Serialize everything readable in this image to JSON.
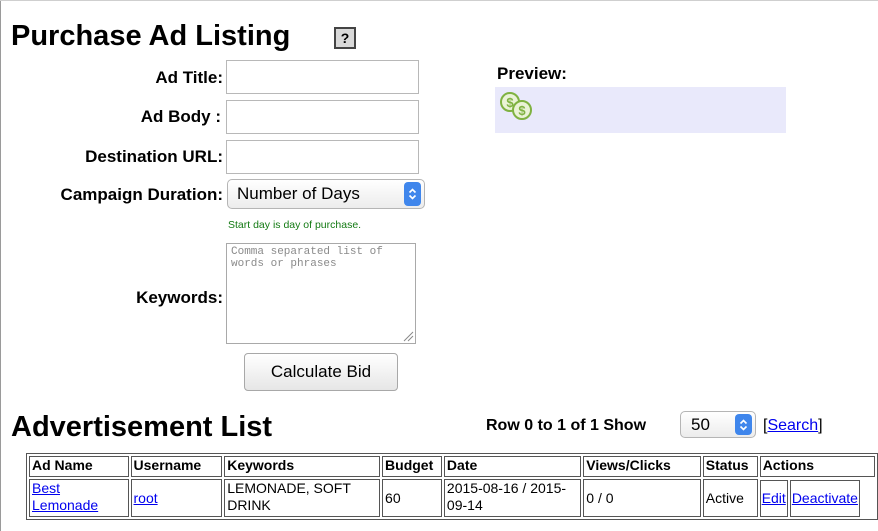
{
  "page": {
    "title": "Purchase Ad Listing",
    "help_label": "?"
  },
  "form": {
    "ad_title_label": "Ad Title:",
    "ad_title_value": "",
    "ad_body_label": "Ad Body :",
    "ad_body_value": "",
    "destination_url_label": "Destination URL:",
    "destination_url_value": "",
    "campaign_duration_label": "Campaign Duration:",
    "campaign_duration_selected": "Number of Days",
    "start_day_hint": "Start day is day of purchase.",
    "keywords_label": "Keywords:",
    "keywords_placeholder": "Comma separated list of words or phrases",
    "calculate_button": "Calculate Bid"
  },
  "preview": {
    "label": "Preview:",
    "icon": "dollar-coins-icon",
    "icon_color": "#7fb241"
  },
  "list": {
    "title": "Advertisement List",
    "row_info": "Row 0 to 1 of 1 Show",
    "show_selected": "50",
    "search_open": "[",
    "search_link": "Search",
    "search_close": "]",
    "columns": [
      "Ad Name",
      "Username",
      "Keywords",
      "Budget",
      "Date",
      "Views/Clicks",
      "Status",
      "Actions"
    ],
    "rows": [
      {
        "ad_name": "Best Lemonade",
        "username": "root",
        "keywords": "LEMONADE, SOFT DRINK",
        "budget": "60",
        "date": "2015-08-16 / 2015-09-14",
        "views_clicks": "0 / 0",
        "status": "Active",
        "edit": "Edit",
        "deactivate": "Deactivate"
      }
    ]
  },
  "colors": {
    "link": "#0000ee",
    "hint": "#137a13",
    "preview_bg": "#e9e9fb",
    "select_accent": "#3f86ec"
  }
}
